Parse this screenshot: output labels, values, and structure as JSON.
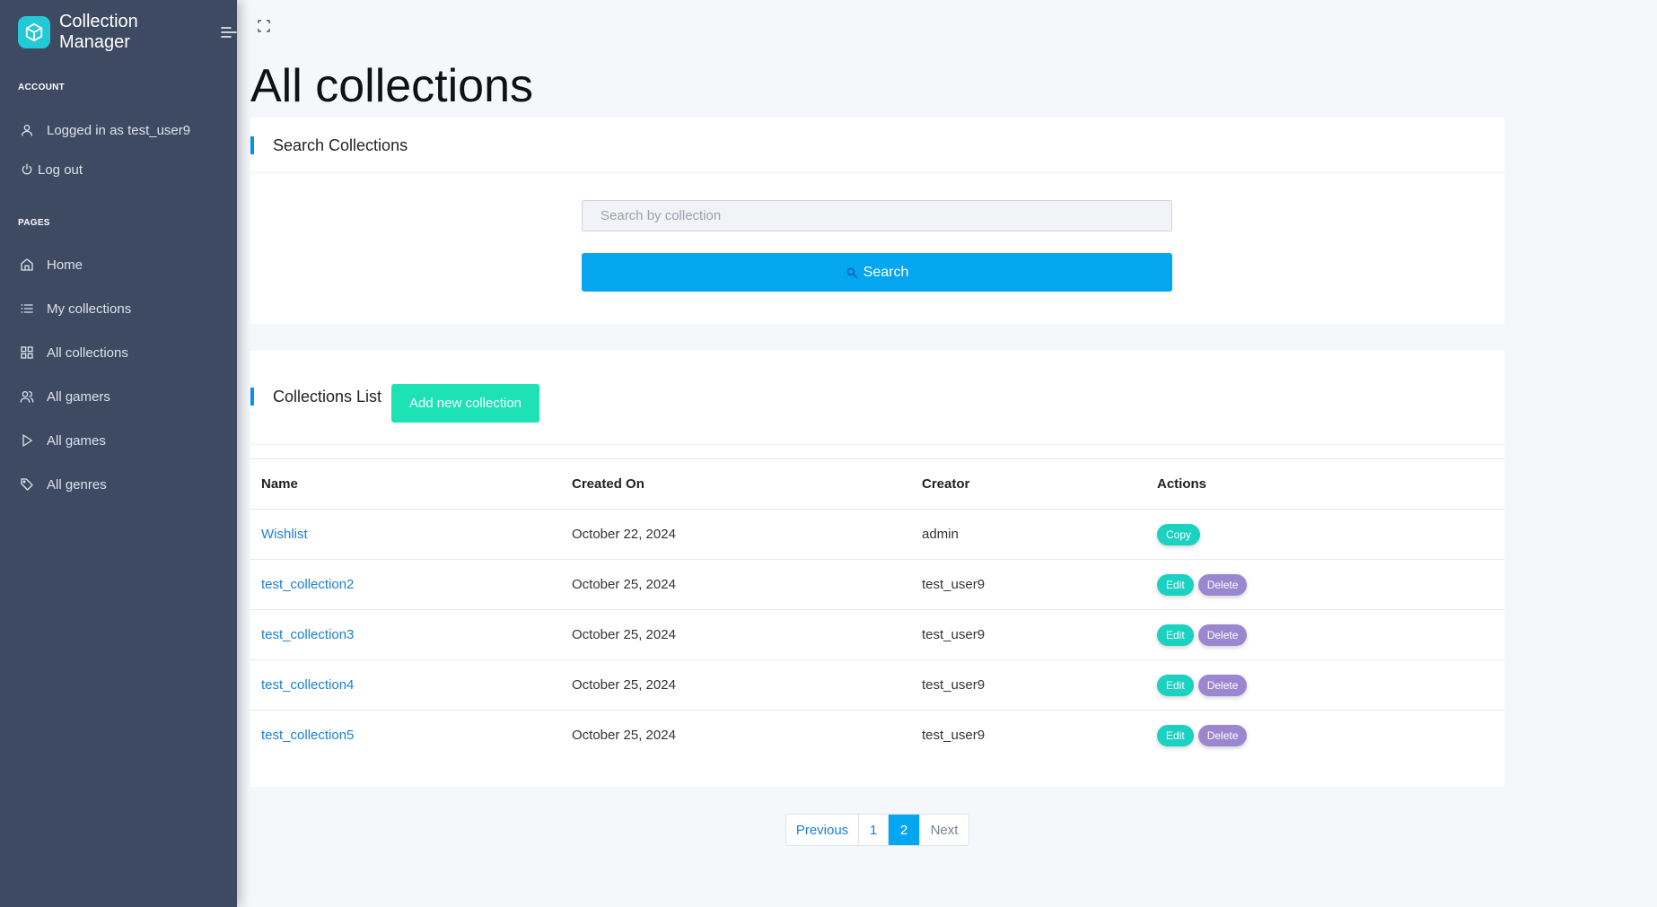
{
  "app": {
    "title": "Collection Manager"
  },
  "sidebar": {
    "account_heading": "ACCOUNT",
    "user_label": "Logged in as test_user9",
    "logout_label": "Log out",
    "pages_heading": "PAGES",
    "items": [
      {
        "label": "Home",
        "icon": "home-icon"
      },
      {
        "label": "My collections",
        "icon": "list-icon"
      },
      {
        "label": "All collections",
        "icon": "grid-icon"
      },
      {
        "label": "All gamers",
        "icon": "users-icon"
      },
      {
        "label": "All games",
        "icon": "play-icon"
      },
      {
        "label": "All genres",
        "icon": "tag-icon"
      }
    ]
  },
  "main": {
    "page_title": "All collections",
    "search": {
      "title": "Search Collections",
      "placeholder": "Search by collection",
      "value": "",
      "button_label": "Search"
    },
    "list": {
      "title": "Collections List",
      "add_button_label": "Add new collection",
      "columns": [
        "Name",
        "Created On",
        "Creator",
        "Actions"
      ],
      "rows": [
        {
          "name": "Wishlist",
          "created_on": "October 22, 2024",
          "creator": "admin",
          "actions": [
            "Copy"
          ]
        },
        {
          "name": "test_collection2",
          "created_on": "October 25, 2024",
          "creator": "test_user9",
          "actions": [
            "Edit",
            "Delete"
          ]
        },
        {
          "name": "test_collection3",
          "created_on": "October 25, 2024",
          "creator": "test_user9",
          "actions": [
            "Edit",
            "Delete"
          ]
        },
        {
          "name": "test_collection4",
          "created_on": "October 25, 2024",
          "creator": "test_user9",
          "actions": [
            "Edit",
            "Delete"
          ]
        },
        {
          "name": "test_collection5",
          "created_on": "October 25, 2024",
          "creator": "test_user9",
          "actions": [
            "Edit",
            "Delete"
          ]
        }
      ]
    },
    "pagination": {
      "previous_label": "Previous",
      "pages": [
        "1",
        "2"
      ],
      "current_page": "2",
      "next_label": "Next"
    }
  },
  "colors": {
    "sidebar_bg": "#3d4a61",
    "accent_blue": "#05a6f0",
    "accent_teal": "#1de2b6",
    "delete_purple": "#9a87cf"
  }
}
